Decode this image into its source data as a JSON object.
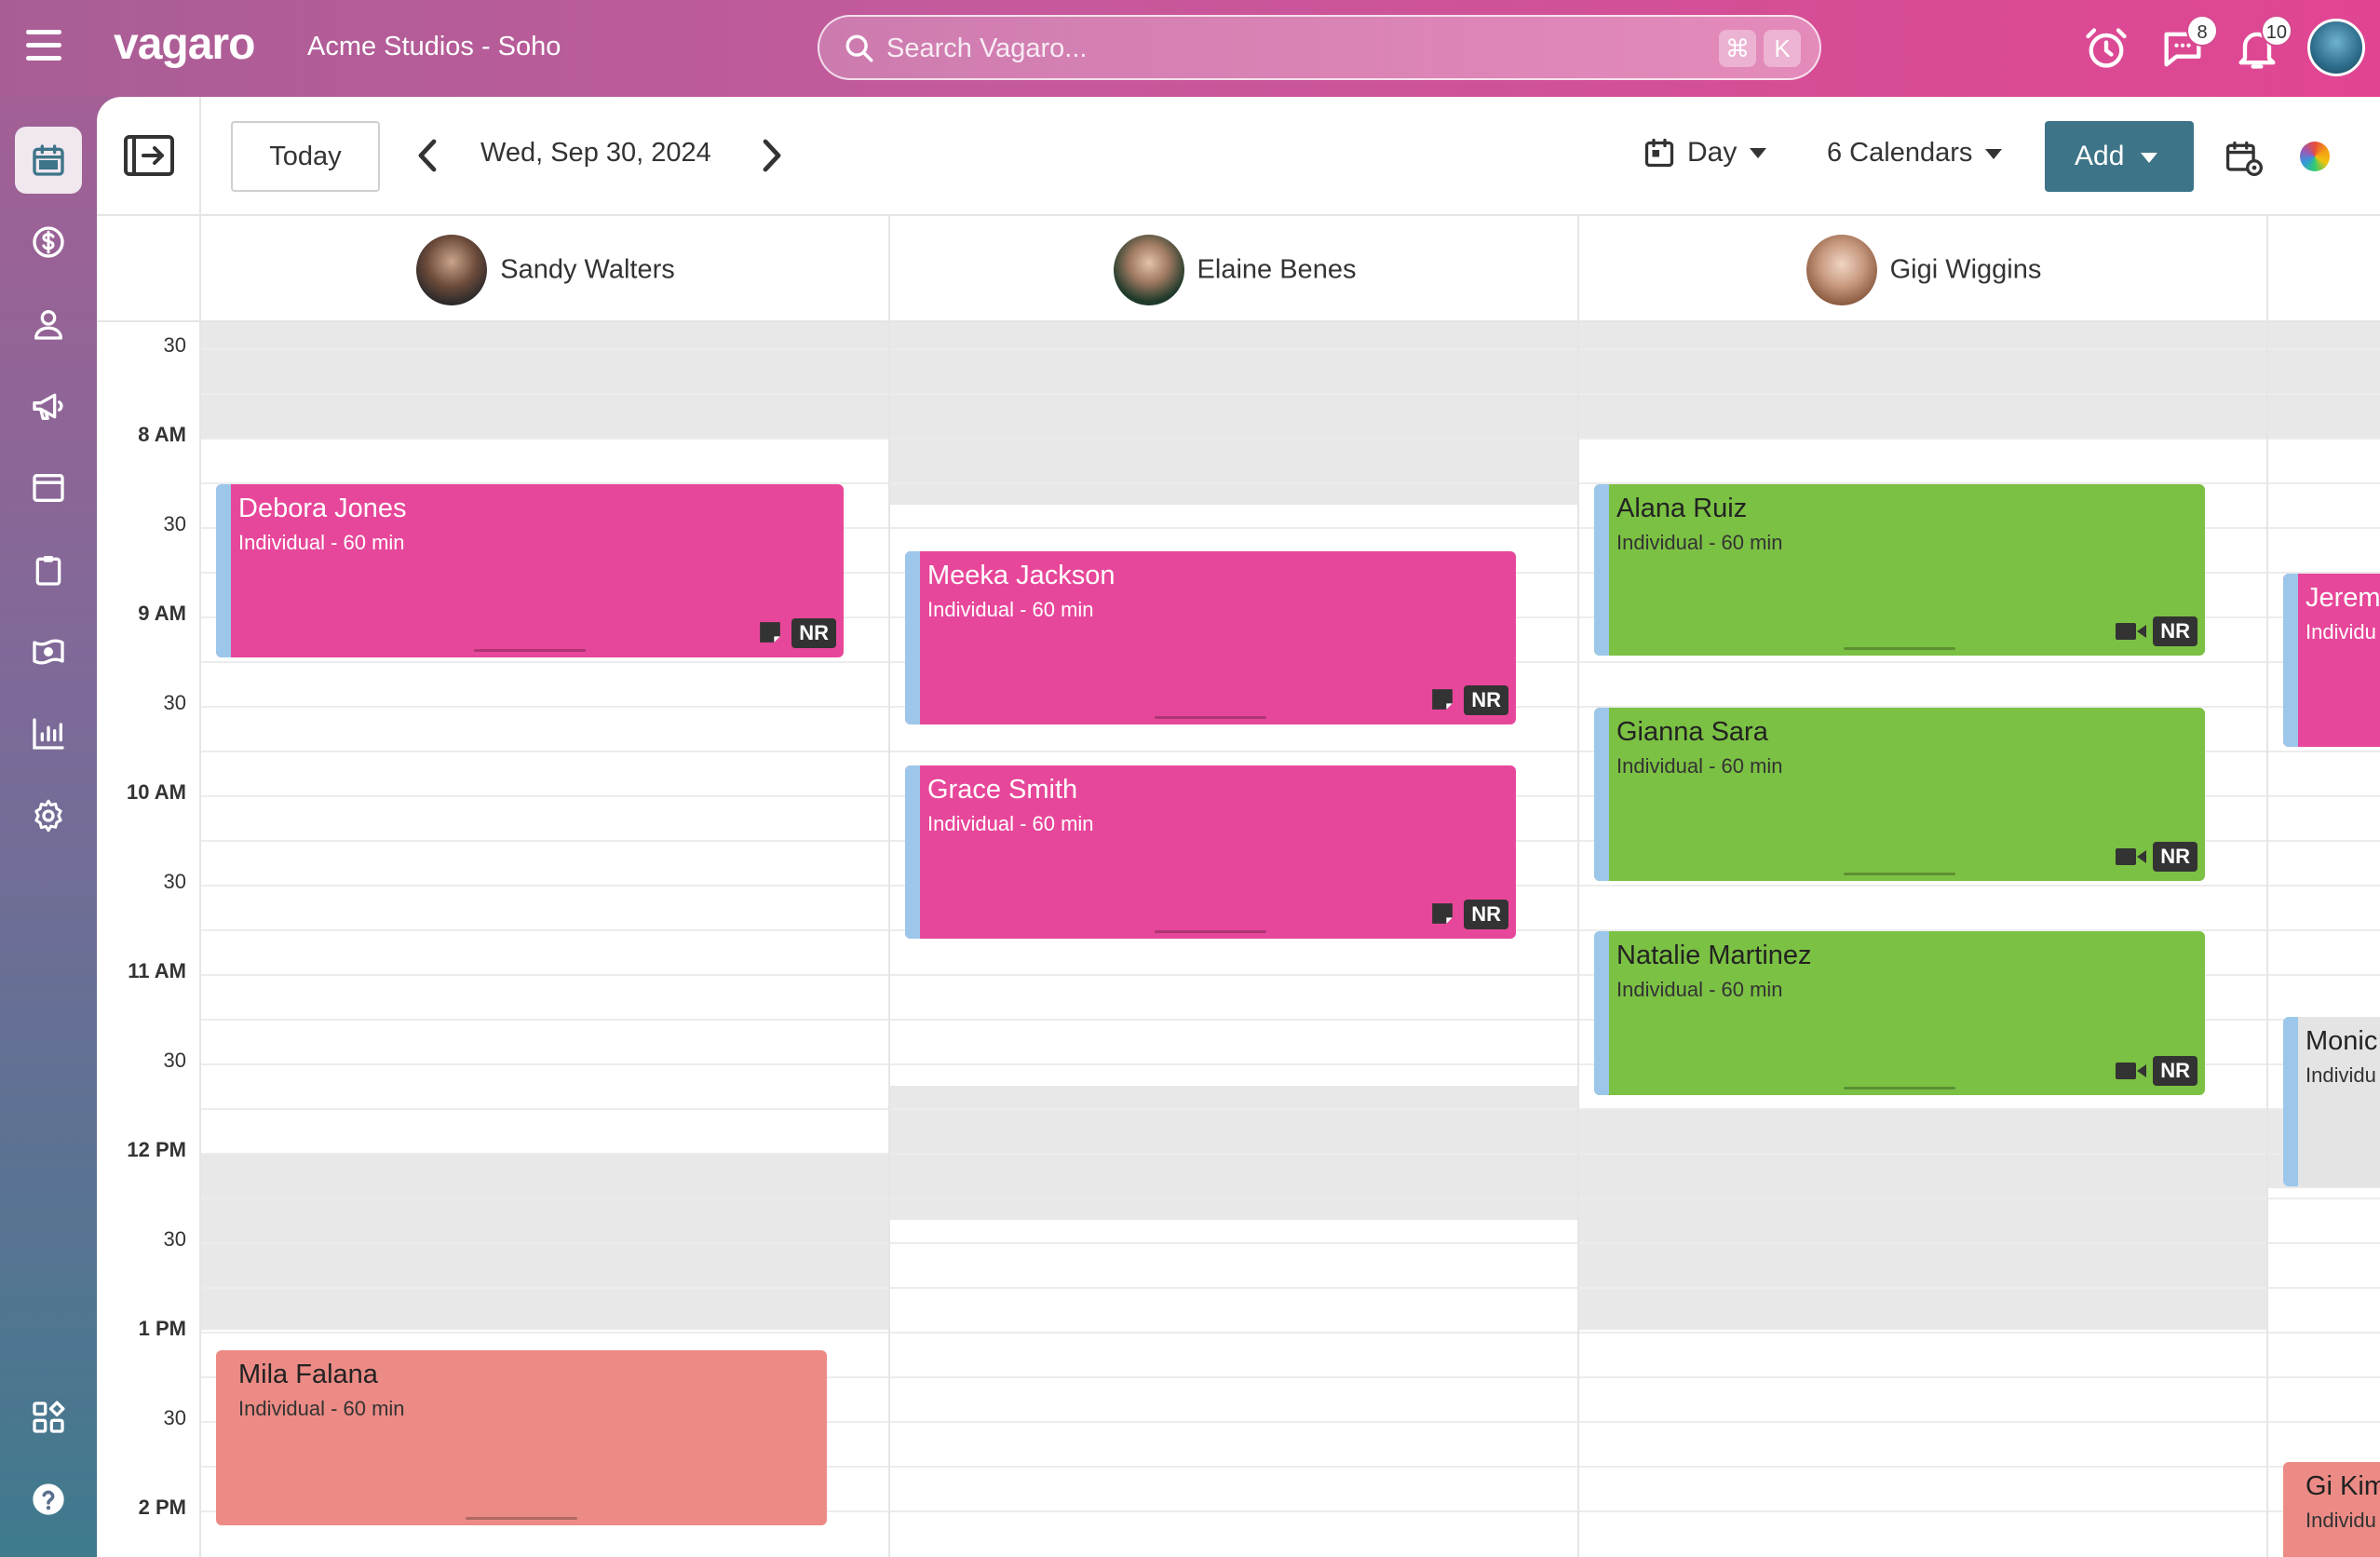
{
  "app": {
    "brand": "vagaro",
    "location": "Acme Studios - Soho",
    "search_placeholder": "Search Vagaro...",
    "search_shortcut": [
      "⌘",
      "K"
    ],
    "messages_count": "8",
    "notifications_count": "10"
  },
  "nav": {
    "items": [
      "calendar-icon",
      "dollar-icon",
      "user-icon",
      "megaphone-icon",
      "browser-icon",
      "clipboard-icon",
      "cash-icon",
      "report-icon",
      "gear-icon",
      "apps-icon",
      "help-icon"
    ],
    "active": "calendar-icon"
  },
  "toolbar": {
    "today_label": "Today",
    "date_label": "Wed, Sep 30, 2024",
    "view_label": "Day",
    "calendars_label": "6 Calendars",
    "add_label": "Add"
  },
  "staff": [
    {
      "name": "Sandy Walters"
    },
    {
      "name": "Elaine Benes"
    },
    {
      "name": "Gigi Wiggins"
    }
  ],
  "time_labels": [
    "30",
    "8 AM",
    "30",
    "9 AM",
    "30",
    "10 AM",
    "30",
    "11 AM",
    "30",
    "12 PM",
    "30",
    "1 PM",
    "30",
    "2 PM"
  ],
  "appointments": [
    {
      "id": "a1",
      "client": "Debora Jones",
      "service": "Individual - 60 min",
      "tag": "NR",
      "color": "#e7479a"
    },
    {
      "id": "a2",
      "client": "Mila Falana",
      "service": "Individual - 60 min",
      "color": "#ec8b85"
    },
    {
      "id": "a3",
      "client": "Meeka Jackson",
      "service": "Individual - 60 min",
      "tag": "NR",
      "color": "#e7479a"
    },
    {
      "id": "a4",
      "client": "Grace Smith",
      "service": "Individual - 60 min",
      "tag": "NR",
      "color": "#e7479a"
    },
    {
      "id": "a5",
      "client": "Alana Ruiz",
      "service": "Individual - 60 min",
      "tag": "NR",
      "color": "#7bc143"
    },
    {
      "id": "a6",
      "client": "Gianna Sara",
      "service": "Individual - 60 min",
      "tag": "NR",
      "color": "#7bc143"
    },
    {
      "id": "a7",
      "client": "Natalie Martinez",
      "service": "Individual - 60 min",
      "tag": "NR",
      "color": "#7bc143"
    },
    {
      "id": "a8",
      "client": "Jerem",
      "service": "Individu",
      "color": "#e7479a"
    },
    {
      "id": "a9",
      "client": "Monic",
      "service": "Individu",
      "color": "#e4e4e4"
    },
    {
      "id": "a10",
      "client": "Gi Kim",
      "service": "Individu",
      "color": "#ec8b85"
    }
  ],
  "colors": {
    "accent": "#3d7488",
    "topbar_pink": "#e14592",
    "nr_tag": "#333333"
  }
}
